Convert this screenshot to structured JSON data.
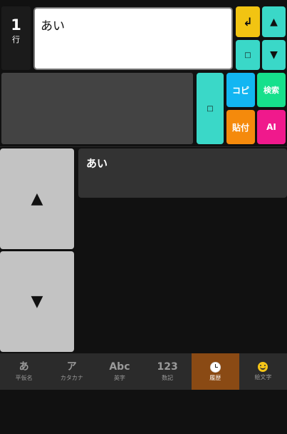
{
  "line_indicator": {
    "number": "1",
    "label": "行"
  },
  "editor": {
    "text": "あい"
  },
  "buttons": {
    "enter": "↲",
    "up_small": "▲",
    "space_small": "□",
    "down_small": "▼",
    "space": "□",
    "copy": "コピ",
    "search": "検索",
    "paste": "貼付",
    "ai": "AI"
  },
  "history": {
    "scroll_up": "▲",
    "scroll_down": "▼",
    "items": [
      "あい"
    ]
  },
  "tabs": [
    {
      "icon": "あ",
      "label": "平仮名",
      "active": false
    },
    {
      "icon": "ア",
      "label": "カタカナ",
      "active": false
    },
    {
      "icon": "Abc",
      "label": "英字",
      "active": false
    },
    {
      "icon": "123",
      "label": "数記",
      "active": false
    },
    {
      "icon": "clock-icon",
      "label": "履歴",
      "active": true
    },
    {
      "icon": "smiley-icon",
      "label": "絵文字",
      "active": false
    }
  ],
  "colors": {
    "enter": "#f2c412",
    "teal": "#3ad8c8",
    "copy": "#12b6f2",
    "search": "#16e08c",
    "paste": "#f58a0c",
    "ai": "#f0198c",
    "active_tab": "#8a4a14"
  }
}
